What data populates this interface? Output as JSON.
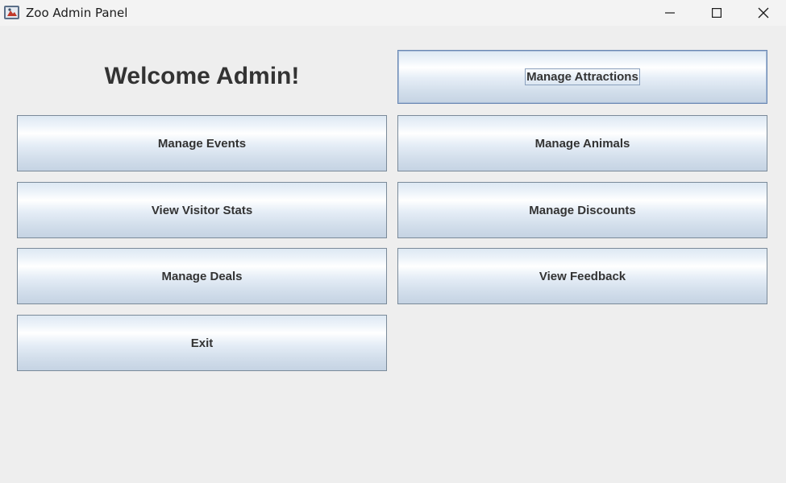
{
  "window": {
    "title": "Zoo Admin Panel",
    "controls": {
      "minimize_icon": "minimize-icon",
      "maximize_icon": "maximize-icon",
      "close_icon": "close-icon"
    }
  },
  "main": {
    "welcome": "Welcome Admin!",
    "buttons": {
      "manage_attractions": "Manage Attractions",
      "manage_events": "Manage Events",
      "manage_animals": "Manage Animals",
      "view_visitor_stats": "View Visitor Stats",
      "manage_discounts": "Manage Discounts",
      "manage_deals": "Manage Deals",
      "view_feedback": "View Feedback",
      "exit": "Exit"
    },
    "focused_button": "Manage Attractions"
  },
  "colors": {
    "background": "#eeeeee",
    "text": "#333333",
    "button_border": "#7a8a99",
    "focus_border": "#6a88b3"
  }
}
